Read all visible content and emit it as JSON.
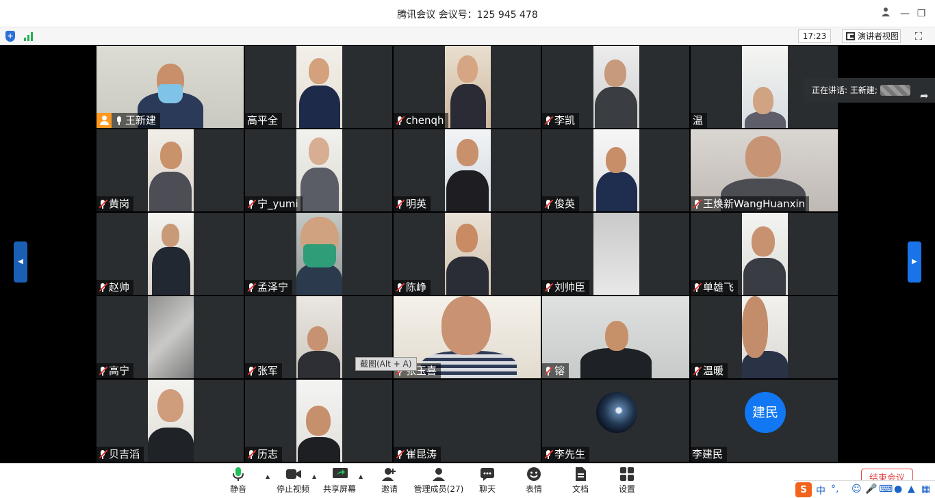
{
  "window": {
    "title": "腾讯会议 会议号：125 945 478",
    "minimize": "—",
    "restore": "❐",
    "close": "✕",
    "account_icon": "person-icon"
  },
  "infobar": {
    "clock": "17:23",
    "speaker_view_label": "演讲者视图",
    "fullscreen_icon": "⛶"
  },
  "speaking": {
    "label": "正在讲话: 王新建;"
  },
  "tooltip": "截图(Alt + A)",
  "participants": [
    {
      "name": "王新建",
      "host": true,
      "muted": false
    },
    {
      "name": "高平全",
      "muted": false,
      "no_mic": true
    },
    {
      "name": "chenqh",
      "muted": true
    },
    {
      "name": "李凯",
      "muted": true
    },
    {
      "name": "温",
      "muted": false,
      "no_mic": true
    },
    {
      "name": "黄岗",
      "muted": true
    },
    {
      "name": "宁_yumi",
      "muted": true
    },
    {
      "name": "明英",
      "muted": true
    },
    {
      "name": "俊英",
      "muted": true
    },
    {
      "name": "王焕新WangHuanxin",
      "muted": true
    },
    {
      "name": "赵帅",
      "muted": true
    },
    {
      "name": "孟泽宁",
      "muted": true
    },
    {
      "name": "陈峥",
      "muted": true
    },
    {
      "name": "刘帅臣",
      "muted": true
    },
    {
      "name": "单雄飞",
      "muted": true
    },
    {
      "name": "高宁",
      "muted": true
    },
    {
      "name": "张军",
      "muted": true
    },
    {
      "name": "张玉喜",
      "muted": true
    },
    {
      "name": "镕",
      "muted": true
    },
    {
      "name": "温暖",
      "muted": true
    },
    {
      "name": "贝吉滔",
      "muted": true
    },
    {
      "name": "历志",
      "muted": true
    },
    {
      "name": "崔昆涛",
      "muted": true
    },
    {
      "name": "李先生",
      "muted": true
    },
    {
      "name": "李建民",
      "muted": false,
      "no_mic": true,
      "avatar_text": "建民"
    }
  ],
  "toolbar": {
    "mute": "静音",
    "stop_video": "停止视频",
    "share_screen": "共享屏幕",
    "invite": "邀请",
    "manage_members": "管理成员(27)",
    "chat": "聊天",
    "reactions": "表情",
    "docs": "文档",
    "settings": "设置",
    "end_meeting": "结束会议"
  },
  "ime": {
    "logo": "S",
    "lang": "中",
    "punct": "°,"
  },
  "colors": {
    "accent": "#1a73e8",
    "host_badge": "#ff9a1f",
    "active_border": "#1fbf5a",
    "end_red": "#e54b4b"
  }
}
